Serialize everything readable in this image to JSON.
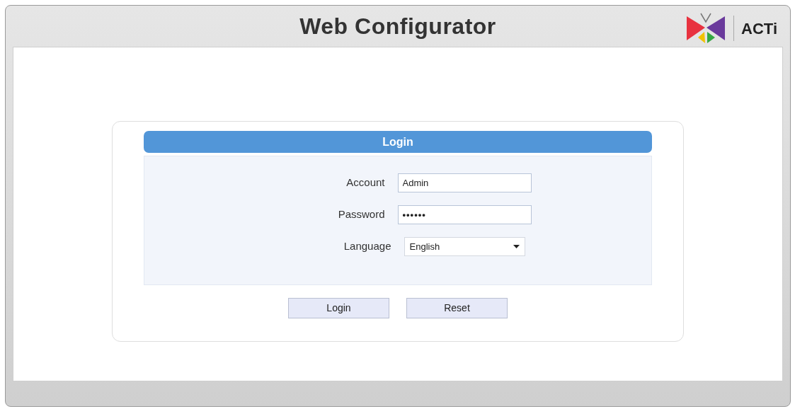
{
  "header": {
    "title": "Web Configurator",
    "brand": "ACTi"
  },
  "login": {
    "title": "Login",
    "fields": [
      {
        "kind": "text",
        "label": "Account",
        "value": "Admin"
      },
      {
        "kind": "password",
        "label": "Password",
        "value": "••••••"
      },
      {
        "kind": "select",
        "label": "Language",
        "value": "English"
      }
    ],
    "buttons": [
      "Login",
      "Reset"
    ]
  }
}
